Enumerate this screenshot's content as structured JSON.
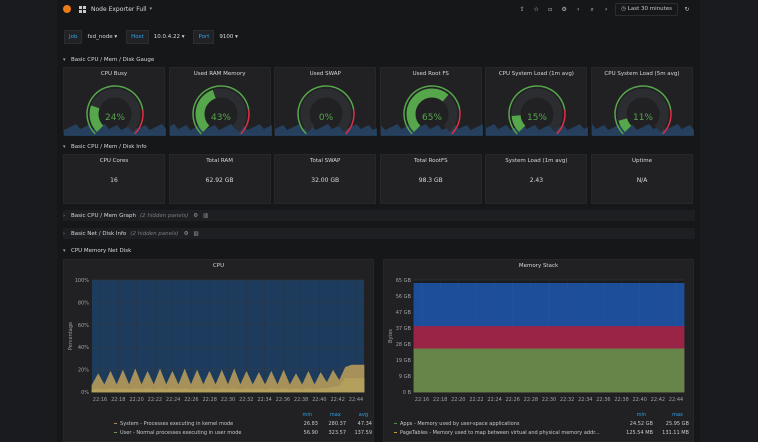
{
  "header": {
    "dashboard_title": "Node Exporter Full",
    "time_range": "Last 30 minutes"
  },
  "variables": [
    {
      "label": "Job",
      "value": "fxd_node"
    },
    {
      "label": "Host",
      "value": "10.0.4.22"
    },
    {
      "label": "Port",
      "value": "9100"
    }
  ],
  "rows": {
    "gauge_row": "Basic CPU / Mem / Disk Gauge",
    "info_row": "Basic CPU / Mem / Disk Info",
    "graph_row": "Basic CPU / Mem Graph",
    "graph_row_hint": "(2 hidden panels)",
    "net_row": "Basic Net / Disk Info",
    "net_row_hint": "(2 hidden panels)",
    "cmnd_row": "CPU Memory Net Disk"
  },
  "gauges": [
    {
      "title": "CPU Busy",
      "value": "24%",
      "fraction": 0.24,
      "color": "#56a64b"
    },
    {
      "title": "Used RAM Memory",
      "value": "43%",
      "fraction": 0.43,
      "color": "#56a64b"
    },
    {
      "title": "Used SWAP",
      "value": "0%",
      "fraction": 0.0,
      "color": "#56a64b"
    },
    {
      "title": "Used Root FS",
      "value": "65%",
      "fraction": 0.65,
      "color": "#56a64b"
    },
    {
      "title": "CPU System Load (1m avg)",
      "value": "15%",
      "fraction": 0.15,
      "color": "#56a64b"
    },
    {
      "title": "CPU System Load (5m avg)",
      "value": "11%",
      "fraction": 0.11,
      "color": "#56a64b"
    }
  ],
  "stats": [
    {
      "title": "CPU Cores",
      "value": "16"
    },
    {
      "title": "Total RAM",
      "value": "62.92 GB"
    },
    {
      "title": "Total SWAP",
      "value": "32.00 GB"
    },
    {
      "title": "Total RootFS",
      "value": "98.3 GB"
    },
    {
      "title": "System Load (1m avg)",
      "value": "2.43"
    },
    {
      "title": "Uptime",
      "value": "N/A"
    }
  ],
  "cpu_panel": {
    "title": "CPU",
    "ylabel": "Percentage",
    "legend_headers": [
      "min",
      "max",
      "avg"
    ],
    "legend": [
      {
        "name": "System - Processes executing in kernel mode",
        "min": "26.83",
        "max": "280.37",
        "avg": "47.34"
      },
      {
        "name": "User - Normal processes executing in user mode",
        "min": "56.90",
        "max": "323.57",
        "avg": "137.59"
      }
    ]
  },
  "mem_panel": {
    "title": "Memory Stack",
    "ylabel": "Bytes",
    "legend_headers": [
      "min",
      "max"
    ],
    "legend": [
      {
        "name": "Apps - Memory used by user-space applications",
        "min": "24.52 GB",
        "max": "25.95 GB"
      },
      {
        "name": "PageTables - Memory used to map between virtual and physical memory addr...",
        "min": "125.54 MB",
        "max": "131.11 MB"
      }
    ]
  },
  "chart_data": [
    {
      "type": "area",
      "title": "CPU",
      "ylabel": "Percentage",
      "x": [
        "22:16",
        "22:18",
        "22:20",
        "22:22",
        "22:24",
        "22:26",
        "22:28",
        "22:30",
        "22:32",
        "22:34",
        "22:36",
        "22:38",
        "22:40",
        "22:42",
        "22:44"
      ],
      "ylim": [
        0,
        100
      ],
      "yticks": [
        "0%",
        "20%",
        "40%",
        "60%",
        "80%",
        "100%"
      ],
      "series": [
        {
          "name": "System",
          "color": "#c0a05a",
          "values": [
            6,
            16,
            6,
            18,
            6,
            19,
            6,
            20,
            6,
            18,
            6,
            20,
            6,
            18,
            6,
            20,
            6,
            19,
            6,
            18,
            6,
            19,
            6,
            20,
            6,
            18,
            6,
            17,
            6,
            18,
            6,
            19,
            6,
            16,
            6,
            18,
            6,
            17,
            8,
            19,
            10,
            22,
            24,
            24,
            24
          ]
        },
        {
          "name": "User",
          "color": "#7eb26d",
          "values": [
            2,
            3,
            2,
            3,
            2,
            3,
            2,
            3,
            2,
            3,
            2,
            3,
            2,
            3,
            2,
            3,
            2,
            3,
            2,
            3,
            2,
            3,
            2,
            3,
            2,
            3,
            2,
            3,
            2,
            3,
            2,
            3,
            2,
            3,
            2,
            3,
            2,
            3,
            3,
            4,
            5,
            12,
            12,
            12,
            12
          ]
        }
      ]
    },
    {
      "type": "area",
      "title": "Memory Stack",
      "ylabel": "Bytes",
      "x": [
        "22:16",
        "22:18",
        "22:20",
        "22:22",
        "22:24",
        "22:26",
        "22:28",
        "22:30",
        "22:32",
        "22:34",
        "22:36",
        "22:38",
        "22:40",
        "22:42",
        "22:44"
      ],
      "ylim": [
        0,
        65
      ],
      "yticks": [
        "0 B",
        "9 GB",
        "19 GB",
        "28 GB",
        "37 GB",
        "47 GB",
        "56 GB",
        "65 GB"
      ],
      "series": [
        {
          "name": "Apps",
          "color": "#56a64b",
          "values": [
            25,
            25,
            25,
            25,
            25,
            25,
            25,
            25,
            25,
            25,
            25,
            25,
            25,
            25,
            25
          ]
        },
        {
          "name": "Cache",
          "color": "#c4162a",
          "values": [
            38,
            38,
            38,
            38,
            38,
            38,
            38,
            38,
            38,
            38,
            38,
            38,
            38,
            38,
            38
          ]
        },
        {
          "name": "Unused",
          "color": "#1f60c4",
          "values": [
            63,
            63,
            63,
            63,
            63,
            63,
            63,
            63,
            63,
            63,
            63,
            63,
            63,
            63,
            63
          ]
        }
      ]
    }
  ]
}
